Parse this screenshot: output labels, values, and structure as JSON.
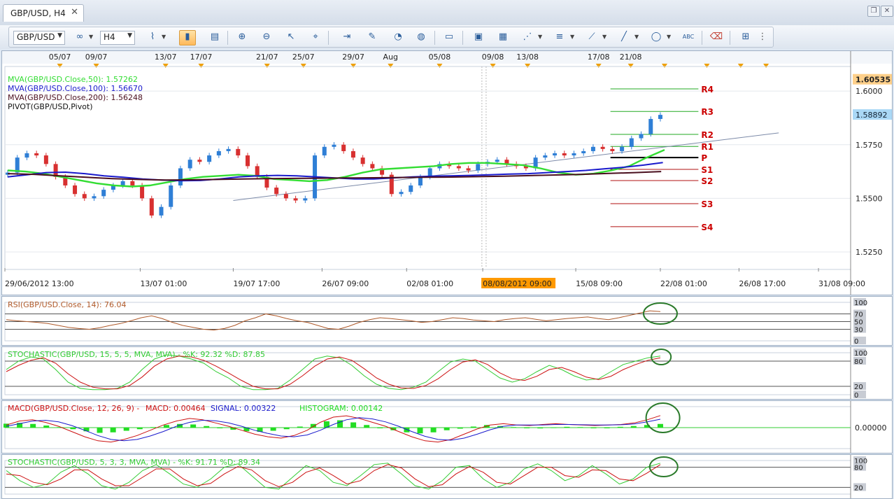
{
  "window": {
    "tab_title": "GBP/USD, H4",
    "tab_close": "✕"
  },
  "toolbar": {
    "symbol": "GBP/USD",
    "timeframe": "H4",
    "tools": [
      "line-chart-icon",
      "candle-chart-icon",
      "bar-chart-icon",
      "zoom-in-icon",
      "zoom-out-icon",
      "pointer-icon",
      "crosshair-icon",
      "scroll-icon",
      "indicator-icon",
      "properties-icon",
      "globe-icon",
      "ruler-icon",
      "image-icon",
      "template-icon",
      "fibonacci-icon",
      "channel-icon",
      "gann-icon",
      "trendline-icon",
      "ellipse-icon",
      "text-icon",
      "eraser-icon",
      "hierarchy-icon",
      "menu-icon"
    ]
  },
  "colors": {
    "mva50": "#33dd33",
    "mva100": "#1a1acc",
    "mva200": "#4a0f1e",
    "pivot_resistance": "#22aa22",
    "pivot_support": "#b01010",
    "pivot_label": "#cc0000",
    "candle_up": "#2f7fd6",
    "candle_down": "#d83030",
    "rsi": "#b05a2a",
    "stoch_k": "#33cc33",
    "stoch_d": "#cc1111",
    "macd": "#cc1111",
    "signal": "#1a1acc",
    "histogram": "#22dd22",
    "highlight_circle": "#2a7a2a",
    "current_price_bg": "#aad8f6",
    "highlight_label_bg": "#ff9900"
  },
  "chart_data": [
    {
      "type": "line",
      "panel": "price",
      "legend": [
        "MVA(GBP/USD.Close,50): 1.57262",
        "MVA(GBP/USD.Close,100): 1.56670",
        "MVA(GBP/USD.Close,200): 1.56248",
        "PIVOT(GBP/USD,Pivot)"
      ],
      "top_date_ticks": [
        "05/07",
        "09/07",
        "13/07",
        "17/07",
        "21/07",
        "25/07",
        "29/07",
        "Aug",
        "05/08",
        "09/08",
        "13/08",
        "17/08",
        "21/08"
      ],
      "x_tick_labels": [
        "29/06/2012 13:00",
        "13/07 01:00",
        "19/07 17:00",
        "26/07 09:00",
        "02/08 01:00",
        "08/08/2012 09:00",
        "15/08 09:00",
        "22/08 01:00",
        "26/08 17:00",
        "31/08 09:00"
      ],
      "highlighted_x_label": "08/08/2012 09:00",
      "y_tick_labels": [
        "1.6000",
        "1.5750",
        "1.5500",
        "1.5250"
      ],
      "ylim": [
        1.5175,
        1.6095
      ],
      "top_price_label": "1.60535",
      "current_price": "1.58892",
      "pivot_levels": [
        {
          "name": "R4",
          "value": 1.601
        },
        {
          "name": "R3",
          "value": 1.5905
        },
        {
          "name": "R2",
          "value": 1.5798
        },
        {
          "name": "R1",
          "value": 1.5742
        },
        {
          "name": "P",
          "value": 1.569
        },
        {
          "name": "S1",
          "value": 1.5635
        },
        {
          "name": "S2",
          "value": 1.5583
        },
        {
          "name": "S3",
          "value": 1.5475
        },
        {
          "name": "S4",
          "value": 1.5368
        }
      ],
      "trendline": {
        "from": [
          0.27,
          1.549
        ],
        "to": [
          0.915,
          1.5805
        ]
      },
      "series": [
        {
          "name": "Close",
          "values": [
            1.562,
            1.569,
            1.571,
            1.57,
            1.566,
            1.56,
            1.556,
            1.552,
            1.55,
            1.551,
            1.554,
            1.556,
            1.558,
            1.556,
            1.55,
            1.542,
            1.546,
            1.556,
            1.564,
            1.568,
            1.567,
            1.57,
            1.572,
            1.573,
            1.57,
            1.565,
            1.56,
            1.555,
            1.552,
            1.55,
            1.549,
            1.55,
            1.57,
            1.574,
            1.575,
            1.572,
            1.569,
            1.566,
            1.564,
            1.561,
            1.552,
            1.553,
            1.556,
            1.56,
            1.564,
            1.566,
            1.565,
            1.564,
            1.563,
            1.566,
            1.567,
            1.568,
            1.566,
            1.565,
            1.564,
            1.569,
            1.57,
            1.571,
            1.57,
            1.571,
            1.572,
            1.574,
            1.573,
            1.572,
            1.574,
            1.578,
            1.58,
            1.587,
            1.5889
          ]
        },
        {
          "name": "MVA 50",
          "values": [
            1.563,
            1.5625,
            1.5615,
            1.56,
            1.5585,
            1.557,
            1.556,
            1.5555,
            1.556,
            1.5575,
            1.559,
            1.56,
            1.5605,
            1.561,
            1.5605,
            1.559,
            1.5585,
            1.558,
            1.5585,
            1.56,
            1.562,
            1.5635,
            1.564,
            1.5645,
            1.565,
            1.566,
            1.5665,
            1.5665,
            1.566,
            1.5655,
            1.564,
            1.562,
            1.561,
            1.5615,
            1.563,
            1.565,
            1.569,
            1.5726
          ]
        },
        {
          "name": "MVA 100",
          "values": [
            1.56,
            1.561,
            1.562,
            1.5622,
            1.5615,
            1.5605,
            1.5598,
            1.559,
            1.5585,
            1.5582,
            1.5583,
            1.559,
            1.56,
            1.5605,
            1.5607,
            1.5605,
            1.56,
            1.5595,
            1.559,
            1.559,
            1.5595,
            1.56,
            1.5603,
            1.5605,
            1.5607,
            1.561,
            1.5613,
            1.5615,
            1.562,
            1.5625,
            1.563,
            1.5638,
            1.5645,
            1.5655,
            1.5667
          ]
        },
        {
          "name": "MVA 200",
          "values": [
            1.5615,
            1.5612,
            1.5605,
            1.5598,
            1.5592,
            1.5588,
            1.5585,
            1.5586,
            1.5588,
            1.559,
            1.5592,
            1.5593,
            1.5594,
            1.5595,
            1.5596,
            1.5597,
            1.5598,
            1.5599,
            1.5601,
            1.5603,
            1.5606,
            1.5609,
            1.5612,
            1.5616,
            1.562,
            1.5625
          ]
        }
      ]
    },
    {
      "type": "line",
      "panel": "rsi",
      "legend": "RSI(GBP/USD.Close, 14): 76.04",
      "y_tick_labels": [
        "100",
        "70",
        "50",
        "30",
        "0"
      ],
      "ylim": [
        0,
        100
      ],
      "levels": [
        70,
        50,
        30
      ],
      "series": [
        {
          "name": "RSI",
          "values": [
            55,
            52,
            50,
            48,
            45,
            40,
            35,
            32,
            30,
            34,
            40,
            45,
            52,
            60,
            65,
            58,
            48,
            40,
            35,
            30,
            28,
            32,
            40,
            52,
            60,
            70,
            65,
            58,
            52,
            48,
            40,
            32,
            30,
            38,
            48,
            55,
            60,
            58,
            55,
            52,
            48,
            50,
            55,
            60,
            58,
            54,
            52,
            50,
            55,
            58,
            60,
            56,
            52,
            55,
            58,
            60,
            62,
            58,
            55,
            60,
            66,
            72,
            78,
            76
          ]
        }
      ]
    },
    {
      "type": "line",
      "panel": "stochastic_15_5_5",
      "legend": "STOCHASTIC(GBP/USD, 15, 5, 5, MVA, MVA) - %K: 92.32  %D: 87.85",
      "y_tick_labels": [
        "100",
        "80",
        "20",
        "0"
      ],
      "ylim": [
        0,
        100
      ],
      "levels": [
        80,
        20
      ],
      "series": [
        {
          "name": "%K",
          "values": [
            60,
            80,
            90,
            85,
            60,
            30,
            15,
            12,
            12,
            15,
            30,
            60,
            85,
            95,
            92,
            85,
            75,
            55,
            40,
            20,
            12,
            12,
            15,
            35,
            60,
            85,
            92,
            88,
            70,
            45,
            25,
            15,
            12,
            18,
            30,
            55,
            78,
            85,
            80,
            60,
            40,
            30,
            38,
            55,
            70,
            60,
            45,
            35,
            38,
            55,
            72,
            80,
            88,
            92
          ]
        },
        {
          "name": "%D",
          "values": [
            55,
            70,
            82,
            88,
            75,
            50,
            30,
            18,
            14,
            14,
            22,
            42,
            68,
            85,
            92,
            90,
            82,
            68,
            52,
            35,
            20,
            14,
            14,
            25,
            45,
            68,
            85,
            90,
            82,
            62,
            40,
            25,
            16,
            15,
            22,
            38,
            60,
            78,
            83,
            72,
            52,
            38,
            34,
            44,
            60,
            65,
            55,
            42,
            36,
            44,
            60,
            72,
            82,
            88
          ]
        }
      ]
    },
    {
      "type": "bar",
      "panel": "macd",
      "legend": [
        "MACD(GBP/USD.Close, 12, 26, 9) - ",
        "MACD: 0.00464",
        "SIGNAL: 0.00322",
        "HISTOGRAM: 0.00142"
      ],
      "y_tick_labels": [
        "0.00000"
      ],
      "ylim": [
        -0.008,
        0.008
      ],
      "series": [
        {
          "name": "MACD",
          "values": [
            0.001,
            0.0025,
            0.003,
            0.002,
            0.0005,
            -0.0015,
            -0.0035,
            -0.005,
            -0.0055,
            -0.0045,
            -0.003,
            -0.001,
            0.001,
            0.0025,
            0.0035,
            0.003,
            0.0018,
            0.0005,
            -0.001,
            -0.0025,
            -0.0035,
            -0.004,
            -0.003,
            -0.001,
            0.002,
            0.004,
            0.0045,
            0.0035,
            0.002,
            0.0005,
            -0.0015,
            -0.0035,
            -0.005,
            -0.0055,
            -0.0045,
            -0.0025,
            -0.0005,
            0.001,
            0.0015,
            0.001,
            0.0008,
            0.0012,
            0.0015,
            0.0012,
            0.001,
            0.0008,
            0.001,
            0.0012,
            0.0018,
            0.003,
            0.0046
          ]
        },
        {
          "name": "SIGNAL",
          "values": [
            0.0005,
            0.0015,
            0.0025,
            0.0028,
            0.0022,
            0.0008,
            -0.001,
            -0.003,
            -0.0045,
            -0.005,
            -0.0045,
            -0.0032,
            -0.0015,
            0.0005,
            0.002,
            0.0028,
            0.0026,
            0.0018,
            0.0005,
            -0.001,
            -0.0022,
            -0.0032,
            -0.0035,
            -0.0028,
            -0.001,
            0.0012,
            0.003,
            0.0038,
            0.0033,
            0.0022,
            0.0005,
            -0.0015,
            -0.0033,
            -0.0045,
            -0.0048,
            -0.004,
            -0.0025,
            -0.0008,
            0.0005,
            0.001,
            0.001,
            0.001,
            0.0012,
            0.0012,
            0.0011,
            0.001,
            0.001,
            0.0011,
            0.0014,
            0.0022,
            0.0032
          ]
        },
        {
          "name": "HISTOGRAM",
          "values": [
            0.0015,
            0.0018,
            0.0014,
            0.0008,
            0.0002,
            -0.0006,
            -0.0014,
            -0.002,
            -0.0018,
            -0.0012,
            -0.0006,
            0.0002,
            0.001,
            0.0014,
            0.0012,
            0.0006,
            -0.0002,
            -0.0008,
            -0.0014,
            -0.0016,
            -0.0012,
            -0.0006,
            0.0004,
            0.0014,
            0.0024,
            0.0028,
            0.002,
            0.001,
            0.0,
            -0.001,
            -0.0018,
            -0.0022,
            -0.0018,
            -0.001,
            -0.0004,
            0.0004,
            0.001,
            0.0006,
            0.0002,
            -0.0002,
            -0.0003,
            0.0001,
            0.0003,
            0.0002,
            -0.0002,
            0.0,
            0.0003,
            0.0006,
            0.001,
            0.0014
          ]
        }
      ]
    },
    {
      "type": "line",
      "panel": "stochastic_5_3_3",
      "legend": "STOCHASTIC(GBP/USD, 5, 3, 3, MVA, MVA) - %K: 91.71  %D: 89.34",
      "y_tick_labels": [
        "100",
        "80",
        "20"
      ],
      "ylim": [
        0,
        100
      ],
      "levels": [
        80,
        20
      ],
      "series": [
        {
          "name": "%K",
          "values": [
            70,
            40,
            20,
            30,
            65,
            85,
            60,
            25,
            15,
            35,
            70,
            88,
            60,
            30,
            20,
            45,
            80,
            90,
            55,
            20,
            15,
            50,
            85,
            70,
            35,
            25,
            55,
            88,
            92,
            60,
            25,
            15,
            40,
            80,
            85,
            45,
            20,
            35,
            75,
            90,
            70,
            40,
            55,
            85,
            60,
            30,
            45,
            80,
            92
          ]
        },
        {
          "name": "%D",
          "values": [
            60,
            55,
            35,
            28,
            45,
            72,
            72,
            45,
            25,
            25,
            50,
            75,
            75,
            45,
            25,
            32,
            60,
            82,
            72,
            40,
            22,
            35,
            65,
            78,
            55,
            30,
            40,
            70,
            88,
            78,
            45,
            22,
            28,
            60,
            82,
            65,
            35,
            30,
            55,
            80,
            80,
            55,
            50,
            72,
            70,
            45,
            40,
            62,
            88
          ]
        }
      ]
    }
  ]
}
